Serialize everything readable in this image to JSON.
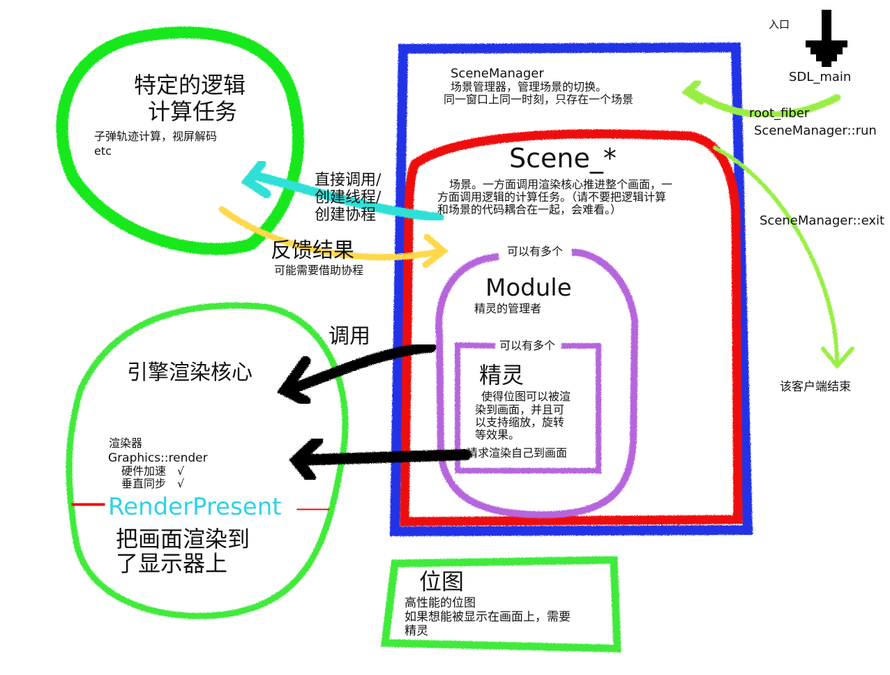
{
  "colors": {
    "green_bright": "#19e81c",
    "green_light": "#3fea3a",
    "blue": "#2233e6",
    "red": "#ee1111",
    "purple": "#b665dd",
    "cyan": "#2fe0d8",
    "yellow": "#ffd84a",
    "lime": "#99ee44",
    "black": "#000000",
    "render_present": "#2ed3e6"
  },
  "icons": [
    "entry-arrow-icon"
  ],
  "entry": {
    "label": "入口",
    "name": "SDL_main"
  },
  "root_fiber": "root_fiber",
  "scene_manager_run": "SceneManager::run",
  "scene_manager_exit": "SceneManager::exit",
  "client_end": "该客户端结束",
  "scene_manager": {
    "title": "SceneManager",
    "desc1": "场景管理器，管理场景的切换。",
    "desc2": "同一窗口上同一时刻，只存在一个场景"
  },
  "scene": {
    "title": "Scene_*",
    "desc1": "场景。一方面调用渲染核心推进整个画面，一",
    "desc2": "方面调用逻辑的计算任务。（请不要把逻辑计算",
    "desc3": "和场景的代码耦合在一起，会难看。）"
  },
  "module": {
    "multi": "可以有多个",
    "title": "Module",
    "desc": "精灵的管理者"
  },
  "sprite": {
    "multi": "可以有多个",
    "title": "精灵",
    "desc1": "使得位图可以被渲",
    "desc2": "染到画面，并且可",
    "desc3": "以支持缩放，旋转",
    "desc4": "等效果。",
    "request": "请求渲染自己到画面"
  },
  "logic": {
    "title1": "特定的逻辑",
    "title2": "计算任务",
    "desc1": "子弹轨迹计算，视屏解码",
    "desc2": "etc"
  },
  "direct_call": {
    "line1": "直接调用/",
    "line2": "创建线程/",
    "line3": "创建协程"
  },
  "feedback": {
    "title": "反馈结果",
    "desc": "可能需要借助协程"
  },
  "call": "调用",
  "engine": {
    "title": "引擎渲染核心",
    "renderer": "渲染器",
    "render_fn": "Graphics::render",
    "hw_accel": "硬件加速　√",
    "vsync": "垂直同步　√",
    "present": "RenderPresent",
    "present_desc1": "把画面渲染到",
    "present_desc2": "了显示器上"
  },
  "bitmap": {
    "title": "位图",
    "desc1": "高性能的位图",
    "desc2": "如果想能被显示在画面上，需要",
    "desc3": "精灵"
  }
}
